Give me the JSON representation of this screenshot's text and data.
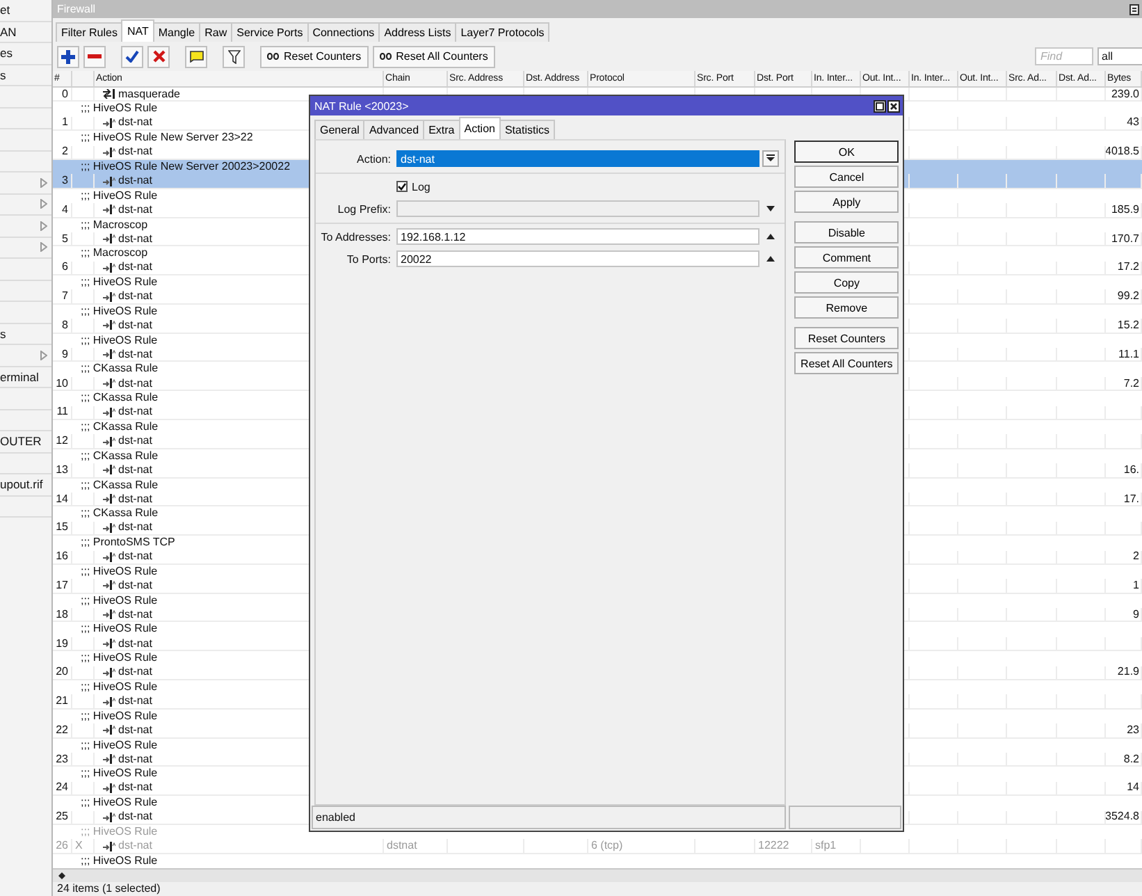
{
  "sidebar": {
    "items": [
      {
        "label": "et",
        "submenu": false
      },
      {
        "label": "AN",
        "submenu": false
      },
      {
        "label": "es",
        "submenu": false
      },
      {
        "label": "s",
        "submenu": false
      },
      {
        "submenu": false
      },
      {
        "submenu": false
      },
      {
        "submenu": false
      },
      {
        "submenu": false
      },
      {
        "submenu": true
      },
      {
        "submenu": true
      },
      {
        "submenu": true
      },
      {
        "submenu": true
      },
      {
        "submenu": false
      },
      {
        "submenu": false
      },
      {
        "submenu": false
      },
      {
        "label": "s",
        "submenu": false
      },
      {
        "submenu": true
      },
      {
        "label": "erminal",
        "submenu": false
      },
      {
        "submenu": false
      },
      {
        "submenu": false
      },
      {
        "label": "OUTER",
        "submenu": false
      },
      {
        "submenu": false
      },
      {
        "label": "upout.rif",
        "submenu": false
      },
      {
        "submenu": false
      }
    ]
  },
  "window": {
    "title": "Firewall"
  },
  "tabs": [
    {
      "label": "Filter Rules",
      "selected": false
    },
    {
      "label": "NAT",
      "selected": true
    },
    {
      "label": "Mangle",
      "selected": false
    },
    {
      "label": "Raw",
      "selected": false
    },
    {
      "label": "Service Ports",
      "selected": false
    },
    {
      "label": "Connections",
      "selected": false
    },
    {
      "label": "Address Lists",
      "selected": false
    },
    {
      "label": "Layer7 Protocols",
      "selected": false
    }
  ],
  "toolbar": {
    "buttons": [
      "Reset Counters",
      "Reset All Counters"
    ],
    "find": {
      "placeholder": "Find"
    },
    "filter": {
      "value": "all"
    }
  },
  "table": {
    "columns": [
      {
        "label": "#"
      },
      {
        "label": "Action"
      },
      {
        "label": "Chain"
      },
      {
        "label": "Src. Address"
      },
      {
        "label": "Dst. Address"
      },
      {
        "label": "Protocol"
      },
      {
        "label": "Src. Port"
      },
      {
        "label": "Dst. Port"
      },
      {
        "label": "In. Inter..."
      },
      {
        "label": "Out. Int..."
      },
      {
        "label": "In. Inter..."
      },
      {
        "label": "Out. Int..."
      },
      {
        "label": "Src. Ad..."
      },
      {
        "label": "Dst. Ad..."
      },
      {
        "label": "Bytes"
      }
    ],
    "rows": [
      {
        "number": "0",
        "kind": "masquerade",
        "action": "masquerade",
        "selected": false,
        "disabled": false,
        "cells": {
          "bytes": "239.0"
        }
      },
      {
        "comment": ";;; HiveOS Rule",
        "number": "1",
        "kind": "dstnat",
        "action": "dst-nat",
        "selected": false,
        "disabled": false,
        "cells": {
          "bytes": "43"
        }
      },
      {
        "comment": ";;; HiveOS Rule New Server 23>22",
        "number": "2",
        "kind": "dstnat",
        "action": "dst-nat",
        "selected": false,
        "disabled": false,
        "cells": {
          "bytes": "4018.5"
        }
      },
      {
        "comment": ";;; HiveOS Rule New Server 20023>20022",
        "number": "3",
        "kind": "dstnat",
        "action": "dst-nat",
        "selected": true,
        "disabled": false
      },
      {
        "comment": ";;; HiveOS Rule",
        "number": "4",
        "kind": "dstnat",
        "action": "dst-nat",
        "selected": false,
        "disabled": false,
        "cells": {
          "bytes": "185.9"
        }
      },
      {
        "comment": ";;; Macroscop",
        "number": "5",
        "kind": "dstnat",
        "action": "dst-nat",
        "selected": false,
        "disabled": false,
        "cells": {
          "bytes": "170.7"
        }
      },
      {
        "comment": ";;; Macroscop",
        "number": "6",
        "kind": "dstnat",
        "action": "dst-nat",
        "selected": false,
        "disabled": false,
        "cells": {
          "bytes": "17.2"
        }
      },
      {
        "comment": ";;; HiveOS Rule",
        "number": "7",
        "kind": "dstnat",
        "action": "dst-nat",
        "selected": false,
        "disabled": false,
        "cells": {
          "bytes": "99.2"
        }
      },
      {
        "comment": ";;; HiveOS Rule",
        "number": "8",
        "kind": "dstnat",
        "action": "dst-nat",
        "selected": false,
        "disabled": false,
        "cells": {
          "bytes": "15.2"
        }
      },
      {
        "comment": ";;; HiveOS Rule",
        "number": "9",
        "kind": "dstnat",
        "action": "dst-nat",
        "selected": false,
        "disabled": false,
        "cells": {
          "bytes": "11.1"
        }
      },
      {
        "comment": ";;; CKassa Rule",
        "number": "10",
        "kind": "dstnat",
        "action": "dst-nat",
        "selected": false,
        "disabled": false,
        "cells": {
          "bytes": "7.2"
        }
      },
      {
        "comment": ";;; CKassa Rule",
        "number": "11",
        "kind": "dstnat",
        "action": "dst-nat",
        "selected": false,
        "disabled": false
      },
      {
        "comment": ";;; CKassa Rule",
        "number": "12",
        "kind": "dstnat",
        "action": "dst-nat",
        "selected": false,
        "disabled": false
      },
      {
        "comment": ";;; CKassa Rule",
        "number": "13",
        "kind": "dstnat",
        "action": "dst-nat",
        "selected": false,
        "disabled": false,
        "cells": {
          "bytes": "16."
        }
      },
      {
        "comment": ";;; CKassa Rule",
        "number": "14",
        "kind": "dstnat",
        "action": "dst-nat",
        "selected": false,
        "disabled": false,
        "cells": {
          "bytes": "17."
        }
      },
      {
        "comment": ";;; CKassa Rule",
        "number": "15",
        "kind": "dstnat",
        "action": "dst-nat",
        "selected": false,
        "disabled": false
      },
      {
        "comment": ";;; ProntoSMS TCP",
        "number": "16",
        "kind": "dstnat",
        "action": "dst-nat",
        "selected": false,
        "disabled": false,
        "cells": {
          "bytes": "2"
        }
      },
      {
        "comment": ";;; HiveOS Rule",
        "number": "17",
        "kind": "dstnat",
        "action": "dst-nat",
        "selected": false,
        "disabled": false,
        "cells": {
          "bytes": "1"
        }
      },
      {
        "comment": ";;; HiveOS Rule",
        "number": "18",
        "kind": "dstnat",
        "action": "dst-nat",
        "selected": false,
        "disabled": false,
        "cells": {
          "bytes": "9"
        }
      },
      {
        "comment": ";;; HiveOS Rule",
        "number": "19",
        "kind": "dstnat",
        "action": "dst-nat",
        "selected": false,
        "disabled": false
      },
      {
        "comment": ";;; HiveOS Rule",
        "number": "20",
        "kind": "dstnat",
        "action": "dst-nat",
        "selected": false,
        "disabled": false,
        "cells": {
          "bytes": "21.9"
        }
      },
      {
        "comment": ";;; HiveOS Rule",
        "number": "21",
        "kind": "dstnat",
        "action": "dst-nat",
        "selected": false,
        "disabled": false
      },
      {
        "comment": ";;; HiveOS Rule",
        "number": "22",
        "kind": "dstnat",
        "action": "dst-nat",
        "selected": false,
        "disabled": false,
        "cells": {
          "bytes": "23"
        }
      },
      {
        "comment": ";;; HiveOS Rule",
        "number": "23",
        "kind": "dstnat",
        "action": "dst-nat",
        "selected": false,
        "disabled": false,
        "cells": {
          "bytes": "8.2"
        }
      },
      {
        "comment": ";;; HiveOS Rule",
        "number": "24",
        "kind": "dstnat",
        "action": "dst-nat",
        "selected": false,
        "disabled": false,
        "cells": {
          "bytes": "14"
        }
      },
      {
        "comment": ";;; HiveOS Rule",
        "number": "25",
        "kind": "dstnat",
        "action": "dst-nat",
        "selected": false,
        "disabled": false,
        "cells": {
          "bytes": "3524.8"
        }
      },
      {
        "comment": ";;; HiveOS Rule",
        "number": "26",
        "flag": "X",
        "kind": "dstnat",
        "action": "dst-nat",
        "selected": false,
        "disabled": true,
        "cells": {
          "chain": "dstnat",
          "protocol": "6 (tcp)",
          "dst_port": "12222",
          "in_interface": "sfp1"
        }
      },
      {
        "comment": ";;; HiveOS Rule",
        "selected": false,
        "disabled": false
      }
    ]
  },
  "status_bar": "24 items (1 selected)",
  "dialog": {
    "title": "NAT Rule <20023>",
    "tabs": [
      {
        "label": "General",
        "selected": false
      },
      {
        "label": "Advanced",
        "selected": false
      },
      {
        "label": "Extra",
        "selected": false
      },
      {
        "label": "Action",
        "selected": true
      },
      {
        "label": "Statistics",
        "selected": false
      }
    ],
    "sections": [
      [
        {
          "kind": "select",
          "label": "Action:",
          "value": "dst-nat",
          "highlighted": true
        }
      ],
      [
        {
          "kind": "checkbox",
          "label": "Log",
          "checked": true
        },
        {
          "kind": "combo",
          "label": "Log Prefix:",
          "disabled": true
        }
      ],
      [
        {
          "kind": "list",
          "label": "To Addresses:",
          "value": "192.168.1.12",
          "disabled": false
        },
        {
          "kind": "list",
          "label": "To Ports:",
          "value": "20022",
          "disabled": false
        }
      ]
    ],
    "buttons": [
      [
        {
          "label": "OK",
          "default": true
        },
        {
          "label": "Cancel",
          "default": false
        },
        {
          "label": "Apply",
          "default": false
        }
      ],
      [
        {
          "label": "Disable",
          "default": false
        },
        {
          "label": "Comment",
          "default": false
        },
        {
          "label": "Copy",
          "default": false
        },
        {
          "label": "Remove",
          "default": false
        }
      ],
      [
        {
          "label": "Reset Counters",
          "default": false
        },
        {
          "label": "Reset All Counters",
          "default": false
        }
      ]
    ],
    "status": "enabled"
  }
}
